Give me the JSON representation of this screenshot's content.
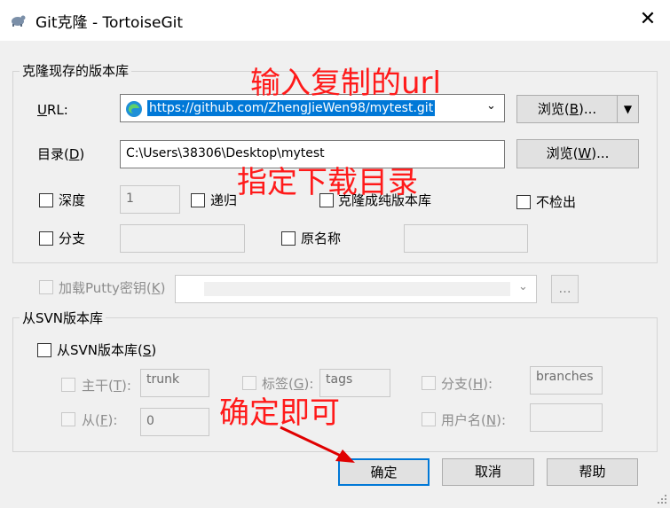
{
  "window": {
    "title": "Git克隆 - TortoiseGit"
  },
  "clone_group": {
    "title": "克隆现存的版本库",
    "url_label": "URL:",
    "url_value": "https://github.com/ZhengJieWen98/mytest.git",
    "browse_url_button": "浏览(B)...",
    "dir_label": "目录(D)",
    "dir_value": "C:\\Users\\38306\\Desktop\\mytest",
    "browse_dir_button": "浏览(W)...",
    "depth_label": "深度",
    "depth_value": "1",
    "recursive_label": "递归",
    "bare_label": "克隆成纯版本库",
    "no_checkout_label": "不检出",
    "branch_label": "分支",
    "origin_label": "原名称"
  },
  "putty": {
    "label": "加载Putty密钥(K)",
    "browse_label": "..."
  },
  "svn_group": {
    "title": "从SVN版本库",
    "from_svn_label": "从SVN版本库(S)",
    "trunk_label": "主干(T):",
    "trunk_value": "trunk",
    "tags_label": "标签(G):",
    "tags_value": "tags",
    "branch_label": "分支(H):",
    "branch_value": "branches",
    "from_label": "从(F):",
    "from_value": "0",
    "username_label": "用户名(N):"
  },
  "buttons": {
    "ok": "确定",
    "cancel": "取消",
    "help": "帮助"
  },
  "annotations": {
    "url_note": "输入复制的url",
    "dir_note": "指定下载目录",
    "ok_note": "确定即可",
    "color": "#ff1a1a"
  }
}
